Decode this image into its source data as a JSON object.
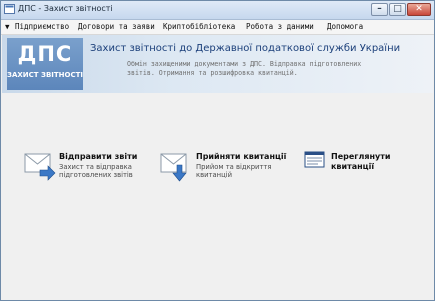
{
  "window": {
    "title": "ДПС - Захист звітності"
  },
  "menu": {
    "items": [
      "Підприємство",
      "Договори та заяви",
      "Криптобібліотека",
      "Робота з даними",
      "Допомога"
    ]
  },
  "banner": {
    "logo": "ДПС",
    "logo_sub": "ЗАХИСТ ЗВІТНОСТІ",
    "title": "Захист звітності до Державної податкової служби України",
    "description_line1": "Обмін захищеними документами з ДПС. Відправка підготовлених",
    "description_line2": "звітів. Отримання  та розшифровка квитанцій."
  },
  "actions": {
    "send": {
      "label": "Відправити звіти",
      "desc_line1": "Захист та відправка",
      "desc_line2": "підготовлених звітів"
    },
    "receive": {
      "label": "Прийняти квитанції",
      "desc_line1": "Прийом та відкриття",
      "desc_line2": "квитанцій"
    },
    "view": {
      "label_line1": "Переглянути",
      "label_line2": "квитанції"
    }
  },
  "colors": {
    "accent": "#1b3f7a",
    "logo_bg": "#6a92c4",
    "arrow_blue": "#3b78c6"
  }
}
